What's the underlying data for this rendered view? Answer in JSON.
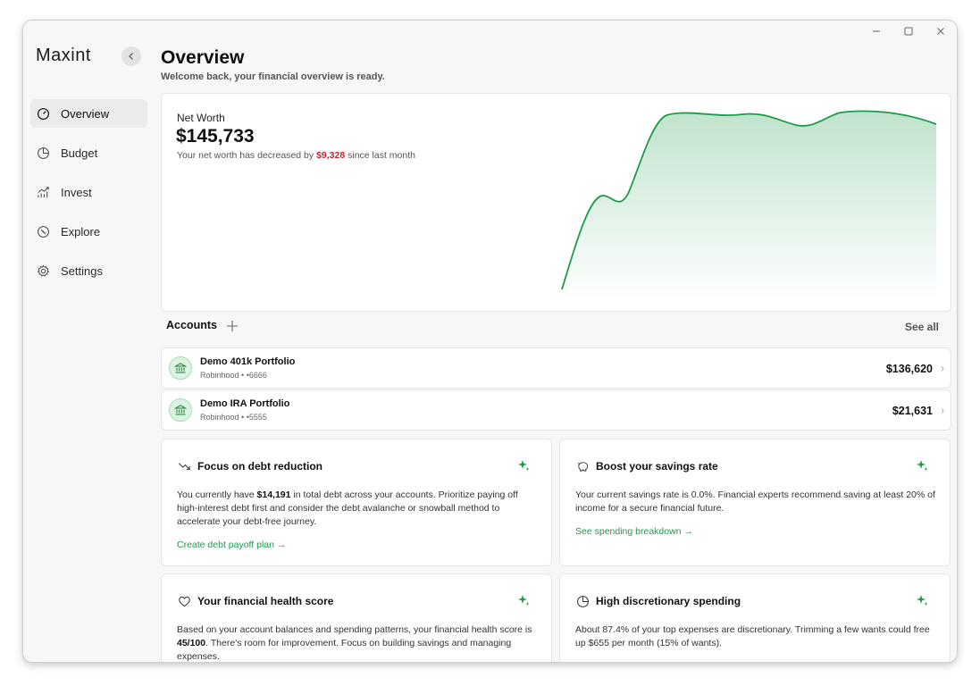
{
  "app": {
    "logo": "Maxint"
  },
  "sidebar": {
    "items": [
      {
        "label": "Overview",
        "icon": "gauge-icon",
        "active": true
      },
      {
        "label": "Budget",
        "icon": "pie-chart-icon"
      },
      {
        "label": "Invest",
        "icon": "growth-chart-icon"
      },
      {
        "label": "Explore",
        "icon": "compass-icon"
      },
      {
        "label": "Settings",
        "icon": "gear-icon"
      }
    ]
  },
  "header": {
    "title": "Overview",
    "subtitle": "Welcome back, your financial overview is ready."
  },
  "net_worth": {
    "label": "Net Worth",
    "value": "$145,733",
    "desc_prefix": "Your net worth has decreased by",
    "desc_amount": "$9,328",
    "desc_suffix": "since last month",
    "line_color": "#1e9a4a"
  },
  "accounts": {
    "title": "Accounts",
    "see_all": "See all",
    "items": [
      {
        "name": "Demo 401k Portfolio",
        "meta": "Robinhood • •6666",
        "value": "$136,620"
      },
      {
        "name": "Demo IRA Portfolio",
        "meta": "Robinhood • •5555",
        "value": "$21,631"
      }
    ]
  },
  "insights": [
    {
      "title": "Focus on debt reduction",
      "icon": "trend-down-icon",
      "body_pre": "You currently have",
      "body_bold": "$14,191",
      "body_post": "in total debt across your accounts. Prioritize paying off high-interest debt first and consider the debt avalanche or snowball method to accelerate your debt-free journey.",
      "link": "Create debt payoff plan →"
    },
    {
      "title": "Boost your savings rate",
      "icon": "piggy-bank-icon",
      "body": "Your current savings rate is 0.0%. Financial experts recommend saving at least 20% of income for a secure financial future.",
      "link": "See spending breakdown →"
    },
    {
      "title": "Your financial health score",
      "icon": "heart-icon",
      "body_pre": "Based on your account balances and spending patterns, your financial health score is",
      "body_bold": "45/100",
      "body_post": ". There's room for improvement. Focus on building savings and managing expenses."
    },
    {
      "title": "High discretionary spending",
      "icon": "pie-chart-icon",
      "body": "About 87.4% of your top expenses are discretionary. Trimming a few wants could free up $655 per month (15% of wants)."
    }
  ],
  "colors": {
    "accent": "#1e9a4a",
    "negative": "#c0272d"
  }
}
